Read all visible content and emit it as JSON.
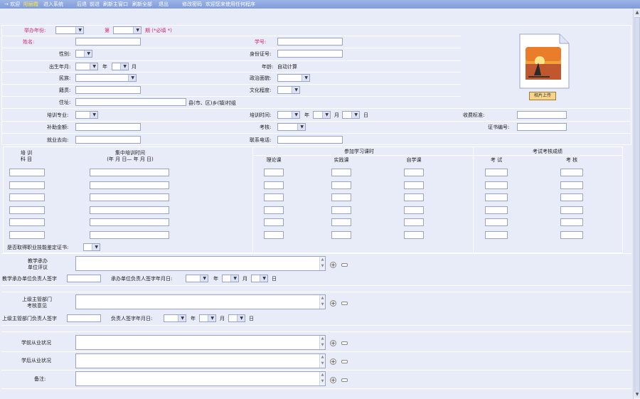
{
  "topbar": {
    "welcome": "→ 欢迎",
    "user": "阳丽霞",
    "enter": "进入系统",
    "back": "后退",
    "forward": "前进",
    "refresh_main": "刷新主窗口",
    "refresh_all": "刷新全部",
    "logout": "退出",
    "change_password": "修改密码",
    "status": "欢迎您来使用任何程序"
  },
  "form": {
    "year_label": "举办年份:",
    "term_label": "第",
    "term_suffix": "期  (*必填 *)",
    "name_label": "姓名:",
    "student_no_label": "学号:",
    "gender_label": "性别:",
    "id_label": "身份证号:",
    "birth_label": "出生年月:",
    "year_unit": "年",
    "month_unit": "月",
    "day_unit": "日",
    "age_label": "年龄:",
    "age_value": "自动计算",
    "ethnicity_label": "民族:",
    "political_label": "政治面貌:",
    "native_label": "籍贯:",
    "education_label": "文化程度:",
    "address_label": "住址:",
    "address_suffix": "县(市、区)乡(镇)村组",
    "major_label": "培训专业:",
    "train_time_label": "培训时间:",
    "fee_label": "收费标准:",
    "subsidy_label": "补助金额:",
    "exam_label": "考核:",
    "cert_no_label": "证书编号:",
    "job_label": "就业去向:",
    "phone_label": "联系电话:",
    "upload_label": "相片上传"
  },
  "table": {
    "col_subject": "培 训\n科 目",
    "col_time": "集中培训时间\n(年 月 日— 年 月 日)",
    "group_hours": "参加学习课时",
    "h_theory": "理论课",
    "h_practice": "实践课",
    "h_self": "自学课",
    "group_exam": "考试考核成绩",
    "h_test": "考 试",
    "h_check": "考 核"
  },
  "lower": {
    "cert_question": "是否取得职业技能鉴定证书:",
    "eval_label": "教学承办\n单位评议",
    "sign1_label": "教学承办单位负责人签字",
    "sign1_date": "承办单位负责人签字年月日:",
    "review_label": "上级主管部门\n考核意见",
    "sign2_label": "上级主管部门负责人签字",
    "sign2_date": "负责人签字年月日:",
    "before_label": "学前从业状况",
    "after_label": "学后从业状况",
    "note_label": "备注:"
  },
  "colors": {
    "topbar": "#8aa6df",
    "background": "#e8ebf8",
    "required": "#d6286f"
  }
}
